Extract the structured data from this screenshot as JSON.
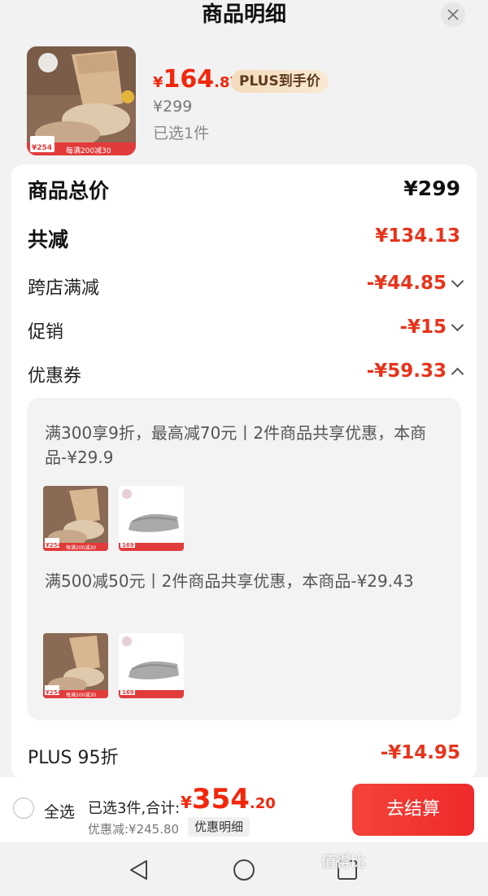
{
  "header": {
    "title": "商品明细"
  },
  "product": {
    "price_yen": "¥",
    "price_int": "164",
    "price_dec": ".87",
    "plus_tag": "PLUS到手价",
    "original_price": "¥299",
    "selected": "已选1件",
    "thumb_badge_price": "¥254",
    "thumb_promo": "每满200减30"
  },
  "summary": {
    "total_label": "商品总价",
    "total_value": "¥299",
    "reduce_label": "共减",
    "reduce_value": "¥134.13",
    "cross_store_label": "跨店满减",
    "cross_store_value": "-¥44.85",
    "promo_label": "促销",
    "promo_value": "-¥15",
    "coupon_label": "优惠券",
    "coupon_value": "-¥59.33",
    "plus_label": "PLUS 95折",
    "plus_value": "-¥14.95"
  },
  "coupons": [
    {
      "text": "满300享9折，最高减70元丨2件商品共享优惠，本商品-¥29.9",
      "items": [
        {
          "name": "shoe-brown",
          "badge": "¥254",
          "promo": "每满200减30"
        },
        {
          "name": "shoe-gray",
          "badge": "169",
          "promo": ""
        }
      ]
    },
    {
      "text": "满500减50元丨2件商品共享优惠，本商品-¥29.43",
      "items": [
        {
          "name": "shoe-brown",
          "badge": "¥254",
          "promo": "每满200减30"
        },
        {
          "name": "shoe-gray",
          "badge": "169",
          "promo": ""
        }
      ]
    }
  ],
  "bottom_bar": {
    "select_all": "全选",
    "total_prefix": "已选3件,合计:",
    "total_yen": "¥",
    "total_int": "354",
    "total_dec": ".20",
    "discount": "优惠减:¥245.80",
    "detail_button": "优惠明细",
    "checkout_button": "去结算"
  },
  "watermark": "值得比",
  "colors": {
    "accent_red": "#f2270c",
    "plus_gold": "#f3dcbc"
  }
}
